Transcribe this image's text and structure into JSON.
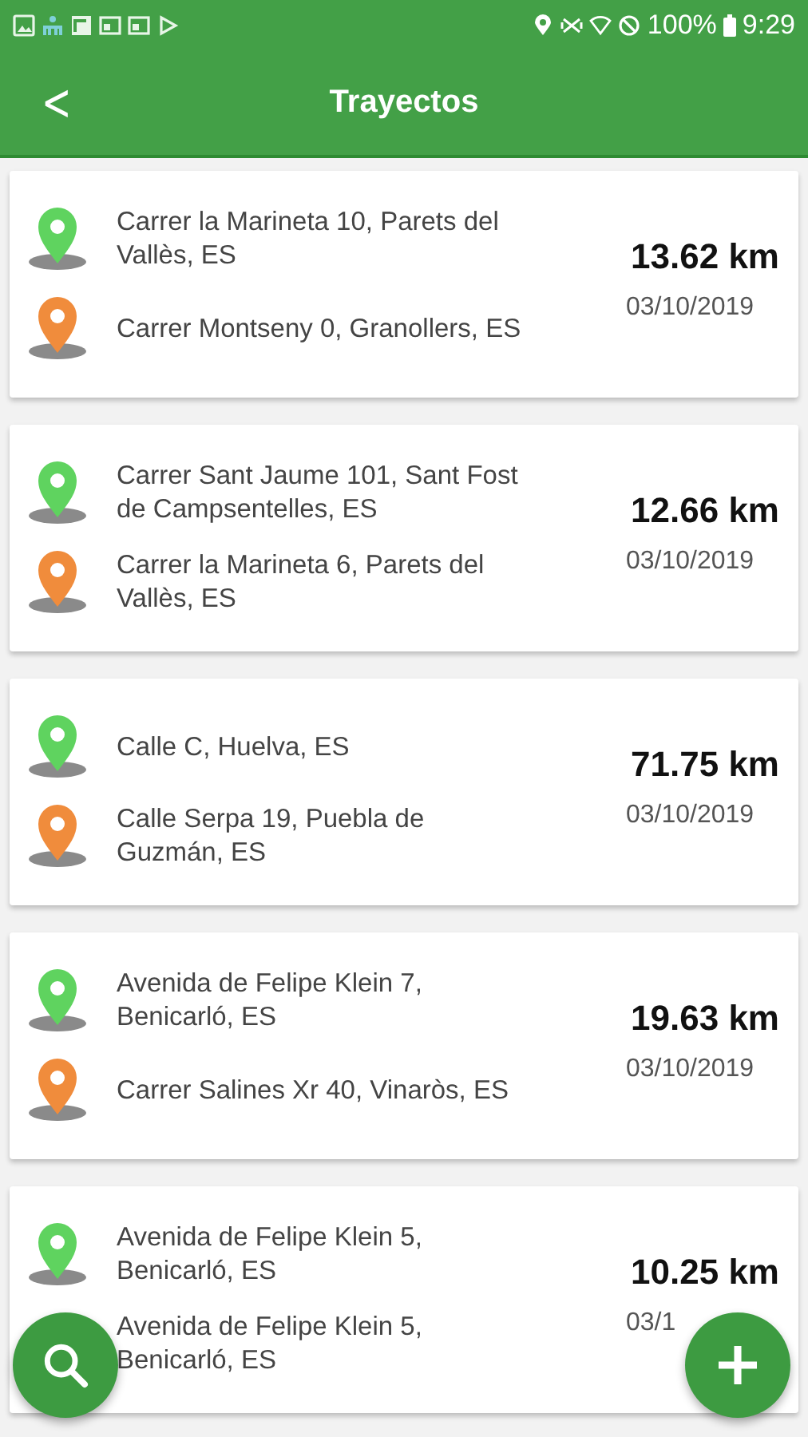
{
  "status_bar": {
    "battery": "100%",
    "time": "9:29"
  },
  "app_bar": {
    "title": "Trayectos",
    "back": "<"
  },
  "trips": [
    {
      "distance": "13.62 km",
      "date": "03/10/2019",
      "stops": [
        {
          "address": "Carrer la Marineta 10, Parets del Vallès, ES",
          "color": "#5fd35f"
        },
        {
          "address": "Carrer Montseny 0, Granollers, ES",
          "color": "#f08c3c"
        }
      ]
    },
    {
      "distance": "12.66 km",
      "date": "03/10/2019",
      "stops": [
        {
          "address": "Carrer Sant Jaume 101, Sant Fost de Campsentelles, ES",
          "color": "#5fd35f"
        },
        {
          "address": "Carrer la Marineta 6, Parets del Vallès, ES",
          "color": "#f08c3c"
        }
      ]
    },
    {
      "distance": "71.75 km",
      "date": "03/10/2019",
      "stops": [
        {
          "address": "Calle C, Huelva, ES",
          "color": "#5fd35f"
        },
        {
          "address": "Calle Serpa 19, Puebla de Guzmán, ES",
          "color": "#f08c3c"
        }
      ]
    },
    {
      "distance": "19.63 km",
      "date": "03/10/2019",
      "stops": [
        {
          "address": "Avenida de Felipe Klein 7, Benicarló, ES",
          "color": "#5fd35f"
        },
        {
          "address": "Carrer Salines Xr 40, Vinaròs, ES",
          "color": "#f08c3c"
        }
      ]
    },
    {
      "distance": "10.25 km",
      "date": "03/1",
      "stops": [
        {
          "address": "Avenida de Felipe Klein 5, Benicarló, ES",
          "color": "#5fd35f"
        },
        {
          "address": "Avenida de Felipe Klein 5, Benicarló, ES"
        }
      ]
    }
  ]
}
